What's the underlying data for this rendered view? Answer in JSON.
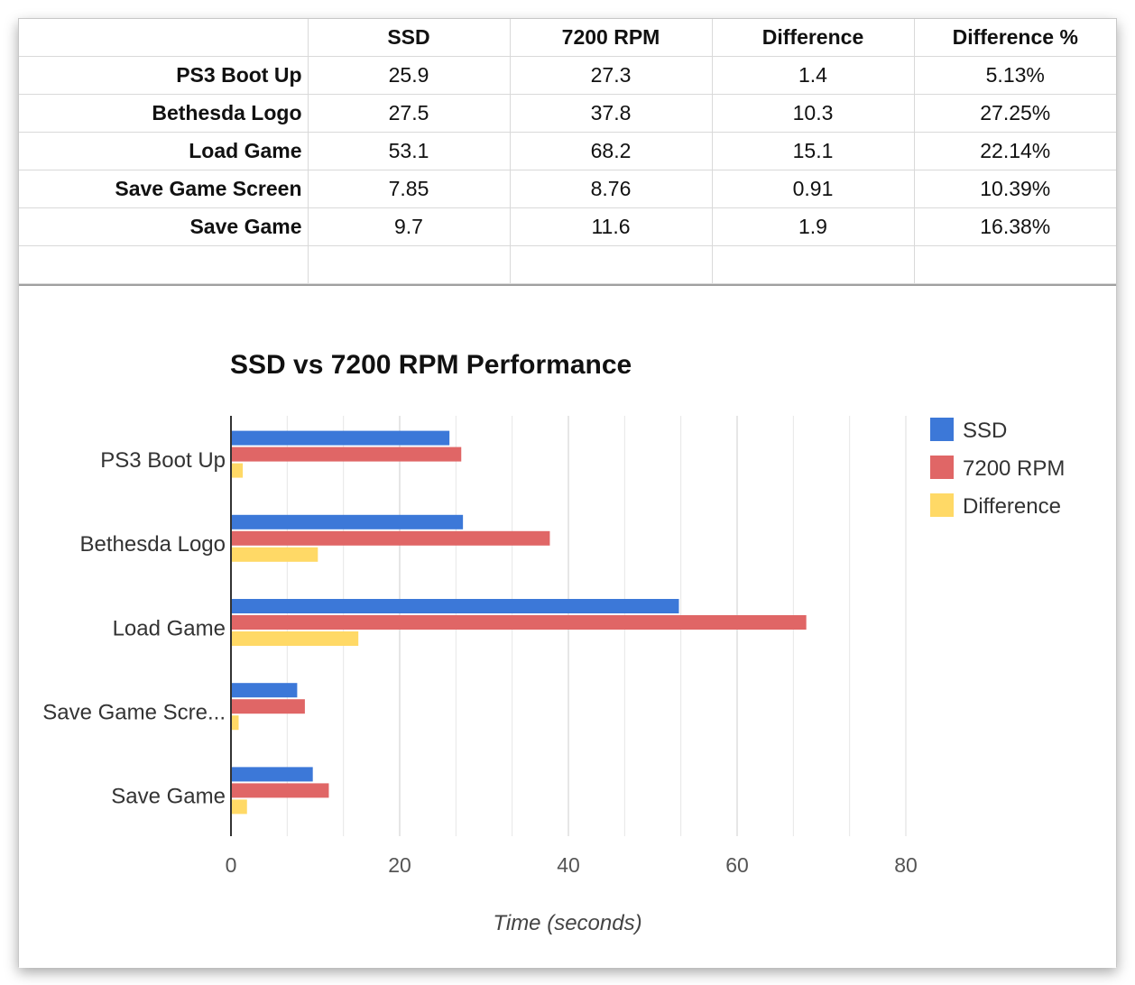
{
  "table": {
    "headers": [
      "",
      "SSD",
      "7200 RPM",
      "Difference",
      "Difference %"
    ],
    "rows": [
      {
        "label": "PS3 Boot Up",
        "ssd": "25.9",
        "rpm": "27.3",
        "diff": "1.4",
        "diff_pct": "5.13%"
      },
      {
        "label": "Bethesda Logo",
        "ssd": "27.5",
        "rpm": "37.8",
        "diff": "10.3",
        "diff_pct": "27.25%"
      },
      {
        "label": "Load Game",
        "ssd": "53.1",
        "rpm": "68.2",
        "diff": "15.1",
        "diff_pct": "22.14%"
      },
      {
        "label": "Save Game Screen",
        "ssd": "7.85",
        "rpm": "8.76",
        "diff": "0.91",
        "diff_pct": "10.39%"
      },
      {
        "label": "Save Game",
        "ssd": "9.7",
        "rpm": "11.6",
        "diff": "1.9",
        "diff_pct": "16.38%"
      }
    ]
  },
  "chart_data": {
    "type": "bar",
    "orientation": "horizontal",
    "title": "SSD vs 7200 RPM Performance",
    "xlabel": "Time (seconds)",
    "ylabel": "",
    "categories": [
      "PS3 Boot Up",
      "Bethesda Logo",
      "Load Game",
      "Save Game Screen",
      "Save Game"
    ],
    "category_display_labels": [
      "PS3 Boot Up",
      "Bethesda Logo",
      "Load Game",
      "Save Game Scre...",
      "Save Game"
    ],
    "series": [
      {
        "name": "SSD",
        "color": "#3c78d8",
        "values": [
          25.9,
          27.5,
          53.1,
          7.85,
          9.7
        ]
      },
      {
        "name": "7200 RPM",
        "color": "#e06666",
        "values": [
          27.3,
          37.8,
          68.2,
          8.76,
          11.6
        ]
      },
      {
        "name": "Difference",
        "color": "#ffd966",
        "values": [
          1.4,
          10.3,
          15.1,
          0.91,
          1.9
        ]
      }
    ],
    "xlim": [
      0,
      80
    ],
    "xticks": [
      0,
      20,
      40,
      60,
      80
    ],
    "minor_gridlines_per_major": 3,
    "grid": true,
    "legend": "right"
  }
}
